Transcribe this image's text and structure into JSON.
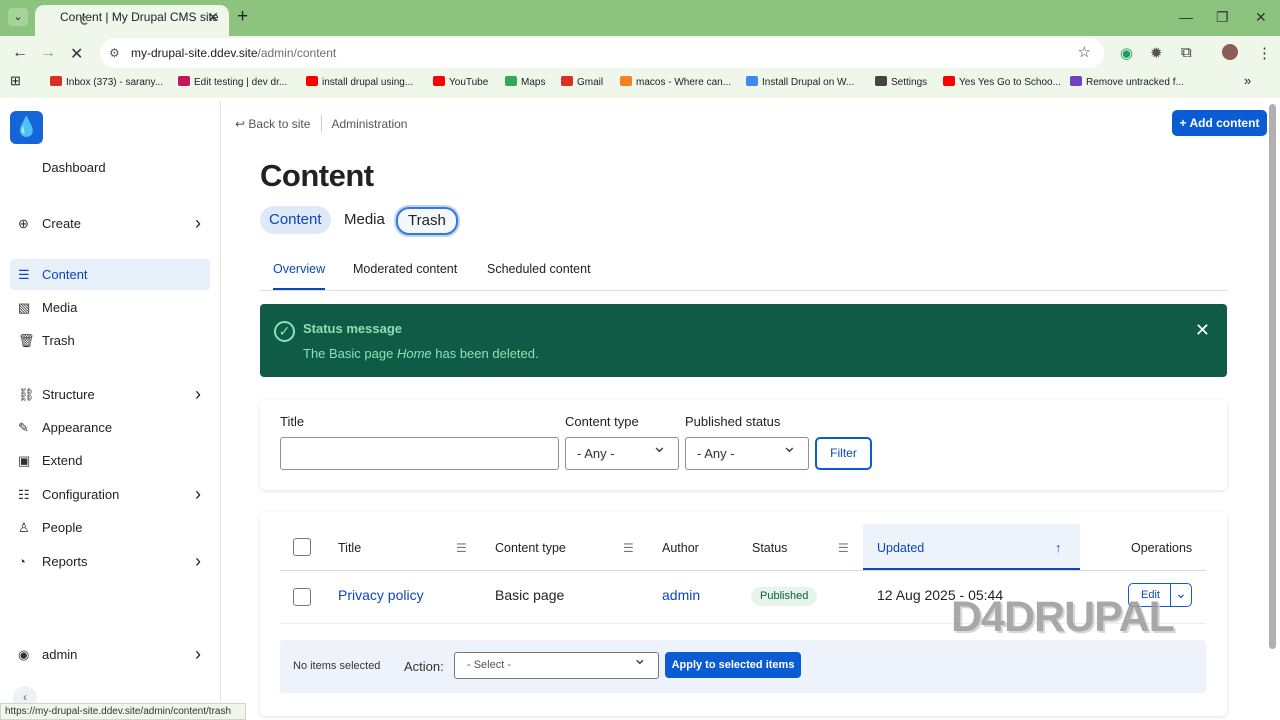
{
  "browser": {
    "tab_title": "Content | My Drupal CMS site",
    "url_host": "my-drupal-site.ddev.site",
    "url_path": "/admin/content",
    "status_url": "https://my-drupal-site.ddev.site/admin/content/trash",
    "bookmarks": [
      {
        "label": "Inbox (373) - sarany...",
        "color": "#d93025"
      },
      {
        "label": "Edit testing | dev dr...",
        "color": "#c2185b"
      },
      {
        "label": "install drupal using...",
        "color": "#ff0000"
      },
      {
        "label": "YouTube",
        "color": "#ff0000"
      },
      {
        "label": "Maps",
        "color": "#34a853"
      },
      {
        "label": "Gmail",
        "color": "#d93025"
      },
      {
        "label": "macos - Where can...",
        "color": "#f48024"
      },
      {
        "label": "Install Drupal on W...",
        "color": "#4285f4"
      },
      {
        "label": "Settings",
        "color": "#444444"
      },
      {
        "label": "Yes Yes Go to Schoo...",
        "color": "#ff0000"
      },
      {
        "label": "Remove untracked f...",
        "color": "#6f42c1"
      }
    ]
  },
  "sidebar": {
    "logo": "💧",
    "dashboard": "Dashboard",
    "items": [
      {
        "label": "Create",
        "icon": "⊕"
      },
      {
        "label": "Content",
        "icon": "☰"
      },
      {
        "label": "Media",
        "icon": "▧"
      },
      {
        "label": "Trash",
        "icon": "🗑"
      },
      {
        "label": "Structure",
        "icon": "⛓"
      },
      {
        "label": "Appearance",
        "icon": "✎"
      },
      {
        "label": "Extend",
        "icon": "▣"
      },
      {
        "label": "Configuration",
        "icon": "☷"
      },
      {
        "label": "People",
        "icon": "♙"
      },
      {
        "label": "Reports",
        "icon": "◔"
      },
      {
        "label": "admin",
        "icon": "◉"
      }
    ]
  },
  "header": {
    "back_to_site": "Back to site",
    "administration": "Administration",
    "add_content": "+ Add content"
  },
  "page": {
    "title": "Content",
    "primary_tabs": [
      "Content",
      "Media",
      "Trash"
    ],
    "secondary_tabs": [
      "Overview",
      "Moderated content",
      "Scheduled content"
    ]
  },
  "status_message": {
    "title": "Status message",
    "prefix": "The Basic page ",
    "node_title": "Home",
    "suffix": " has been deleted."
  },
  "filters": {
    "title_label": "Title",
    "content_type_label": "Content type",
    "content_type_value": "- Any -",
    "published_status_label": "Published status",
    "published_status_value": "- Any -",
    "filter_button": "Filter"
  },
  "table": {
    "columns": [
      "Title",
      "Content type",
      "Author",
      "Status",
      "Updated",
      "Operations"
    ],
    "rows": [
      {
        "title": "Privacy policy",
        "content_type": "Basic page",
        "author": "admin",
        "status": "Published",
        "updated": "12 Aug 2025 - 05:44",
        "operation": "Edit"
      }
    ]
  },
  "bulk": {
    "selection_text": "No items selected",
    "action_label": "Action:",
    "select_value": "- Select -",
    "apply_button": "Apply to selected items"
  },
  "watermark": "D4DRUPAL",
  "colors": {
    "chrome_green": "#8bc37f",
    "drupal_blue": "#0b5bd3",
    "success_green": "#0f5b45"
  }
}
